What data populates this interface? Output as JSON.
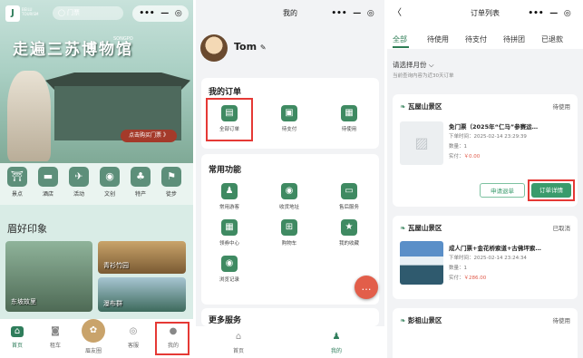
{
  "panel1": {
    "logo_char": "J",
    "logo_text": "BEILU\nTOURISM",
    "search": "◯ 门票",
    "capsule": [
      "•••",
      "—",
      "◎"
    ],
    "hero_banner": "走遍三苏博物馆",
    "hero_tag": "SONGPO",
    "hero_cta": "点击购买门票 》",
    "functions": [
      {
        "label": "景点",
        "icon": "⛩"
      },
      {
        "label": "酒店",
        "icon": "▬"
      },
      {
        "label": "活动",
        "icon": "✈"
      },
      {
        "label": "文创",
        "icon": "◉"
      },
      {
        "label": "特产",
        "icon": "♣"
      },
      {
        "label": "徒步",
        "icon": "⚑"
      }
    ],
    "section_title": "眉好印象",
    "thumbs": [
      "东坡故里",
      "青衫竹园",
      "",
      "瀑布群"
    ],
    "tabs": [
      {
        "label": "首页",
        "icon": "⌂"
      },
      {
        "label": "租车",
        "icon": "◙"
      },
      {
        "label": "眉友圈",
        "icon": "✿"
      },
      {
        "label": "客服",
        "icon": "◎"
      },
      {
        "label": "我的",
        "icon": "●"
      }
    ]
  },
  "panel2": {
    "title": "我的",
    "capsule": [
      "•••",
      "—",
      "◎"
    ],
    "username": "Tom",
    "edit_icon": "✎",
    "orders_title": "我的订单",
    "orders": [
      {
        "label": "全部订单",
        "icon": "▤"
      },
      {
        "label": "待支付",
        "icon": "▣"
      },
      {
        "label": "待使用",
        "icon": "▦"
      }
    ],
    "common_title": "常用功能",
    "common": [
      {
        "label": "常用游客",
        "icon": "♟"
      },
      {
        "label": "收货地址",
        "icon": "◉"
      },
      {
        "label": "售后服务",
        "icon": "▭"
      },
      {
        "label": "领券中心",
        "icon": "▦"
      },
      {
        "label": "购物车",
        "icon": "⊞"
      },
      {
        "label": "我的收藏",
        "icon": "★"
      },
      {
        "label": "浏览记录",
        "icon": "◉"
      }
    ],
    "more_title": "更多服务",
    "fab_icon": "…",
    "tabs": [
      {
        "label": "首页",
        "icon": "⌂"
      },
      {
        "label": "我的",
        "icon": "♟"
      }
    ]
  },
  "panel3": {
    "back": "〈",
    "title": "订单列表",
    "capsule": [
      "•••",
      "—",
      "◎"
    ],
    "tabs": [
      "全部",
      "待使用",
      "待支付",
      "待拼团",
      "已退款"
    ],
    "month_filter": "请选择月份 ⌵",
    "query_hint": "当前查询内容为近30天订单",
    "orders": [
      {
        "shop": "瓦屋山景区",
        "status": "待使用",
        "title": "免门票（2025年“仁马”参赛运…",
        "time": "下单时间：2025-02-14 23:29:39",
        "qty": "数量：1",
        "paid_label": "实付：",
        "paid": "￥0.00",
        "btn1": "申请退单",
        "btn2": "订单详情"
      },
      {
        "shop": "瓦屋山景区",
        "status": "已取消",
        "title": "成人门票+金花桥索道+古佛坪索…",
        "time": "下单时间：2025-02-14 23:24:34",
        "qty": "数量：1",
        "paid_label": "实付：",
        "paid": "￥286.00"
      },
      {
        "shop": "彭祖山景区",
        "status": "待使用"
      }
    ]
  }
}
